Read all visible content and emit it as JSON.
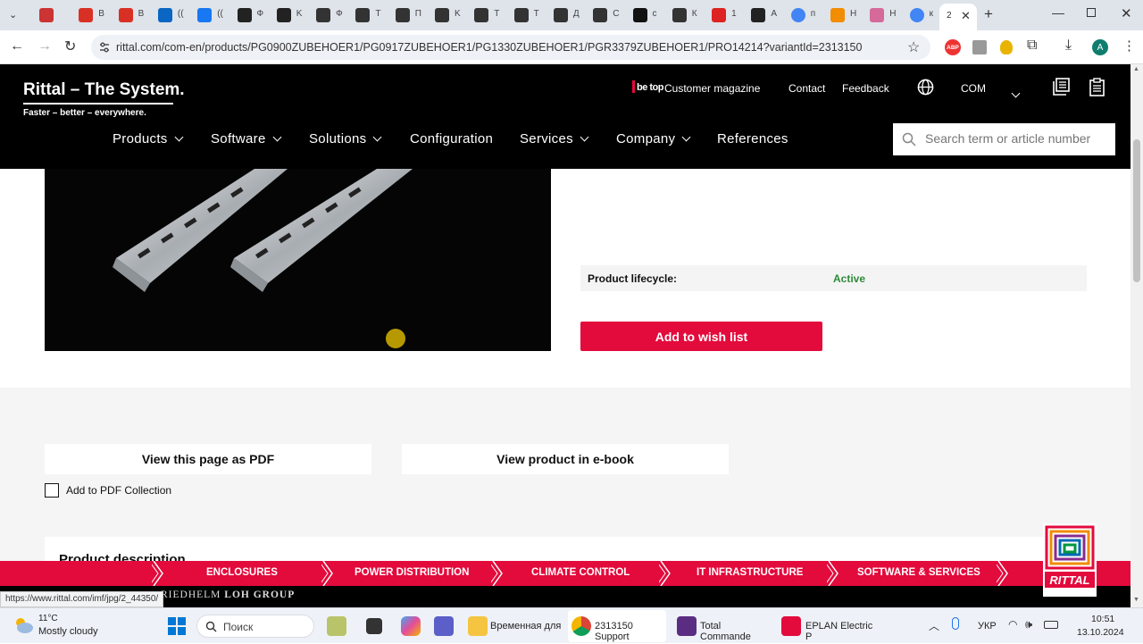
{
  "browser": {
    "tabs": [
      {
        "icon": "ad-icon",
        "label": ""
      },
      {
        "icon": "gmail-icon",
        "label": "В"
      },
      {
        "icon": "gmail-icon",
        "label": "В"
      },
      {
        "icon": "linkedin-icon",
        "label": "(("
      },
      {
        "icon": "facebook-icon",
        "label": "(("
      },
      {
        "icon": "sh-icon",
        "label": "Ф"
      },
      {
        "icon": "sh-icon",
        "label": "K"
      },
      {
        "icon": "avatar-icon",
        "label": "Ф"
      },
      {
        "icon": "avatar-icon",
        "label": "T"
      },
      {
        "icon": "avatar-icon",
        "label": "П"
      },
      {
        "icon": "avatar-icon",
        "label": "K"
      },
      {
        "icon": "avatar-icon",
        "label": "T"
      },
      {
        "icon": "avatar-icon",
        "label": "T"
      },
      {
        "icon": "avatar-icon",
        "label": "Д"
      },
      {
        "icon": "avatar-icon",
        "label": "С"
      },
      {
        "icon": "openai-icon",
        "label": "с"
      },
      {
        "icon": "avatar-icon",
        "label": "К"
      },
      {
        "icon": "k-icon",
        "label": "1"
      },
      {
        "icon": "hd-icon",
        "label": "A"
      },
      {
        "icon": "google-icon",
        "label": "п"
      },
      {
        "icon": "orange-icon",
        "label": "Н"
      },
      {
        "icon": "puzzle-icon",
        "label": "Н"
      },
      {
        "icon": "google-icon",
        "label": "к"
      }
    ],
    "active_tab_label": "2",
    "url": "rittal.com/com-en/products/PG0900ZUBEHOER1/PG0917ZUBEHOER1/PG1330ZUBEHOER1/PGR3379ZUBEHOER1/PRO14214?variantId=2313150",
    "profile_initial": "A",
    "status_url": "https://www.rittal.com/imf/jpg/2_44350/"
  },
  "header": {
    "logo": "Rittal – The System.",
    "tagline": "Faster – better – everywhere.",
    "magazine_brand": "be top",
    "magazine": "Customer magazine",
    "contact": "Contact",
    "feedback": "Feedback",
    "region": "COM",
    "nav": {
      "products": "Products",
      "software": "Software",
      "solutions": "Solutions",
      "configuration": "Configuration",
      "services": "Services",
      "company": "Company",
      "references": "References"
    },
    "search_placeholder": "Search term or article number"
  },
  "product": {
    "lifecycle_label": "Product lifecycle:",
    "lifecycle_value": "Active",
    "wish_button": "Add to wish list",
    "pdf_button": "View this page as PDF",
    "ebook_button": "View product in e-book",
    "pdf_collection": "Add to PDF Collection",
    "description_title": "Product description"
  },
  "banner": {
    "items": [
      "ENCLOSURES",
      "POWER DISTRIBUTION",
      "CLIMATE CONTROL",
      "IT INFRASTRUCTURE",
      "SOFTWARE & SERVICES"
    ],
    "group_prefix": "RIEDHELM",
    "group_name": "LOH GROUP",
    "brand": "RITTAL"
  },
  "taskbar": {
    "weather_temp": "11°C",
    "weather_desc": "Mostly cloudy",
    "search": "Поиск",
    "apps": [
      {
        "icon": "folder-icon",
        "label": "Временная для"
      },
      {
        "icon": "chrome-icon",
        "label": "2313150 Support"
      },
      {
        "icon": "totalcmd-icon",
        "label": "Total Commande"
      },
      {
        "icon": "eplan-icon",
        "label": "EPLAN Electric P"
      }
    ],
    "language": "УКР",
    "time": "10:51",
    "date": "13.10.2024"
  },
  "colors": {
    "rittal_red": "#e30a3c",
    "active_green": "#2e8b3a",
    "header_black": "#000000"
  }
}
